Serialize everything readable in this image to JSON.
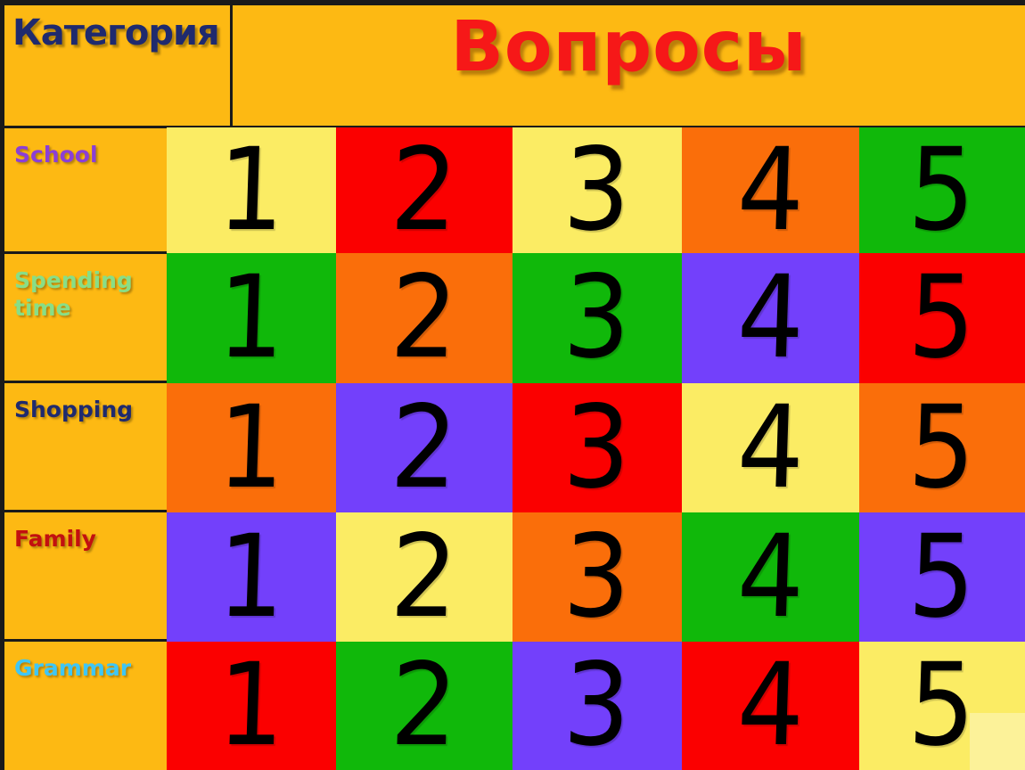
{
  "window": {
    "background_color": "#FDB913",
    "frame_color": "#1a1a1a"
  },
  "header": {
    "category_label": "Категория",
    "category_color": "#1F2A6E",
    "title": "Вопросы",
    "title_color": "#F61818"
  },
  "palette": {
    "yellow": "#FBEC64",
    "red": "#FB0000",
    "orange": "#FA6E0A",
    "green": "#10B80A",
    "purple": "#7340FB",
    "panel": "#FDB913",
    "number": "#000000"
  },
  "categories": [
    {
      "label": "School",
      "color": "#8B3FD6"
    },
    {
      "label": "Spending time",
      "color": "#88DE87"
    },
    {
      "label": "Shopping",
      "color": "#1F2A6E"
    },
    {
      "label": "Family",
      "color": "#C21010"
    },
    {
      "label": "Grammar",
      "color": "#3FC6F5"
    }
  ],
  "grid": {
    "columns": 5,
    "rows": 5,
    "cells": [
      [
        {
          "number": "1",
          "color": "#FBEC64"
        },
        {
          "number": "2",
          "color": "#FB0000"
        },
        {
          "number": "3",
          "color": "#FBEC64"
        },
        {
          "number": "4",
          "color": "#FA6E0A"
        },
        {
          "number": "5",
          "color": "#10B80A"
        }
      ],
      [
        {
          "number": "1",
          "color": "#10B80A"
        },
        {
          "number": "2",
          "color": "#FA6E0A"
        },
        {
          "number": "3",
          "color": "#10B80A"
        },
        {
          "number": "4",
          "color": "#7340FB"
        },
        {
          "number": "5",
          "color": "#FB0000"
        }
      ],
      [
        {
          "number": "1",
          "color": "#FA6E0A"
        },
        {
          "number": "2",
          "color": "#7340FB"
        },
        {
          "number": "3",
          "color": "#FB0000"
        },
        {
          "number": "4",
          "color": "#FBEC64"
        },
        {
          "number": "5",
          "color": "#FA6E0A"
        }
      ],
      [
        {
          "number": "1",
          "color": "#7340FB"
        },
        {
          "number": "2",
          "color": "#FBEC64"
        },
        {
          "number": "3",
          "color": "#FA6E0A"
        },
        {
          "number": "4",
          "color": "#10B80A"
        },
        {
          "number": "5",
          "color": "#7340FB"
        }
      ],
      [
        {
          "number": "1",
          "color": "#FB0000"
        },
        {
          "number": "2",
          "color": "#10B80A"
        },
        {
          "number": "3",
          "color": "#7340FB"
        },
        {
          "number": "4",
          "color": "#FB0000"
        },
        {
          "number": "5",
          "color": "#FBEC64"
        }
      ]
    ]
  },
  "layout": {
    "col_edges": [
      0,
      190,
      388,
      578,
      777,
      963
    ],
    "row_edges": [
      0,
      141,
      287,
      432,
      577,
      721
    ],
    "cat_row_tops": [
      144,
      285,
      430,
      575,
      720
    ],
    "cat_row_bottom": 864
  }
}
